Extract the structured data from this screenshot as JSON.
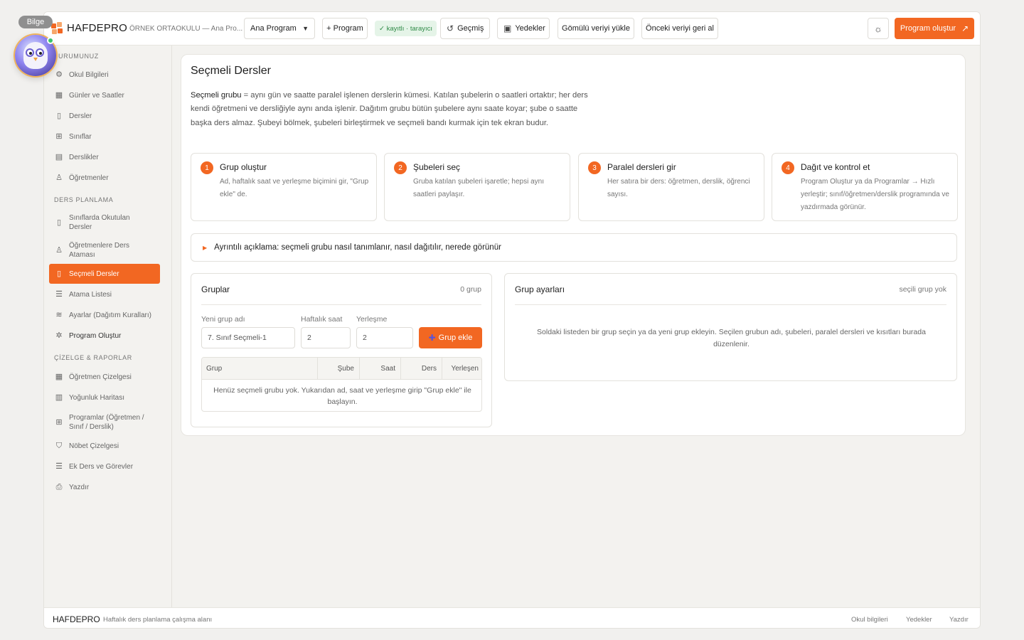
{
  "assistant": {
    "name": "Bilge"
  },
  "header": {
    "brand": "HAFDEPRO",
    "school": "ÖRNEK ORTAOKULU — Ana Pro...",
    "program_select": "Ana Program",
    "new_program": "+ Program",
    "scanner_status": "✓ kayıtlı · tarayıcı",
    "history": "Geçmiş",
    "backups": "Yedekler",
    "load_embedded": "Gömülü veriyi yükle",
    "restore_previous": "Önceki veriyi geri al",
    "create_program": "Program oluştur"
  },
  "sidebar": {
    "section1": "URUMUNUZ",
    "items1": [
      "Okul Bilgileri",
      "Günler ve Saatler",
      "Dersler",
      "Sınıflar",
      "Derslikler",
      "Öğretmenler"
    ],
    "section2": "DERS PLANLAMA",
    "items2": [
      "Sınıflarda Okutulan Dersler",
      "Öğretmenlere Ders Ataması",
      "Seçmeli Dersler",
      "Atama Listesi",
      "Ayarlar (Dağıtım Kuralları)",
      "Program Oluştur"
    ],
    "section3": "ÇİZELGE & RAPORLAR",
    "items3": [
      "Öğretmen Çizelgesi",
      "Yoğunluk Haritası",
      "Programlar (Öğretmen / Sınıf / Derslik)",
      "Nöbet Çizelgesi",
      "Ek Ders ve Görevler",
      "Yazdır"
    ]
  },
  "main": {
    "title": "Seçmeli Dersler",
    "intro_bold": "Seçmeli grubu",
    "intro_rest": " = aynı gün ve saatte paralel işlenen derslerin kümesi. Katılan şubelerin o saatleri ortaktır; her ders kendi öğretmeni ve dersliğiyle aynı anda işlenir. Dağıtım grubu bütün şubelere aynı saate koyar; şube o saatte başka ders almaz. Şubeyi bölmek, şubeleri birleştirmek ve seçmeli bandı kurmak için tek ekran budur.",
    "steps": [
      {
        "num": "1",
        "title": "Grup oluştur",
        "desc": "Ad, haftalık saat ve yerleşme biçimini gir, \"Grup ekle\" de."
      },
      {
        "num": "2",
        "title": "Şubeleri seç",
        "desc": "Gruba katılan şubeleri işaretle; hepsi aynı saatleri paylaşır."
      },
      {
        "num": "3",
        "title": "Paralel dersleri gir",
        "desc": "Her satıra bir ders: öğretmen, derslik, öğrenci sayısı."
      },
      {
        "num": "4",
        "title": "Dağıt ve kontrol et",
        "desc": "Program Oluştur ya da Programlar → Hızlı yerleştir; sınıf/öğretmen/derslik programında ve yazdırmada görünür."
      }
    ],
    "details_summary": "Ayrıntılı açıklama: seçmeli grubu nasıl tanımlanır, nasıl dağıtılır, nerede görünür"
  },
  "groups_panel": {
    "title": "Gruplar",
    "count": "0 grup",
    "label_name": "Yeni grup adı",
    "label_hours": "Haftalık saat",
    "label_placement": "Yerleşme",
    "value_name": "7. Sınıf Seçmeli-1",
    "value_hours": "2",
    "value_placement": "2",
    "add_button": "Grup ekle",
    "columns": [
      "Grup",
      "Şube",
      "Saat",
      "Ders",
      "Yerleşen"
    ],
    "empty": "Henüz seçmeli grubu yok. Yukarıdan ad, saat ve yerleşme girip \"Grup ekle\" ile başlayın."
  },
  "settings_panel": {
    "title": "Grup ayarları",
    "status": "seçili grup yok",
    "empty": "Soldaki listeden bir grup seçin ya da yeni grup ekleyin. Seçilen grubun adı, şubeleri, paralel dersleri ve kısıtları burada düzenlenir."
  },
  "footer": {
    "brand": "HAFDEPRO",
    "subtitle": "Haftalık ders planlama çalışma alanı",
    "links": [
      "Okul bilgileri",
      "Yedekler",
      "Yazdır"
    ]
  },
  "colors": {
    "accent": "#f26722",
    "success_bg": "#e5f4e8",
    "success_text": "#2e8a46"
  }
}
